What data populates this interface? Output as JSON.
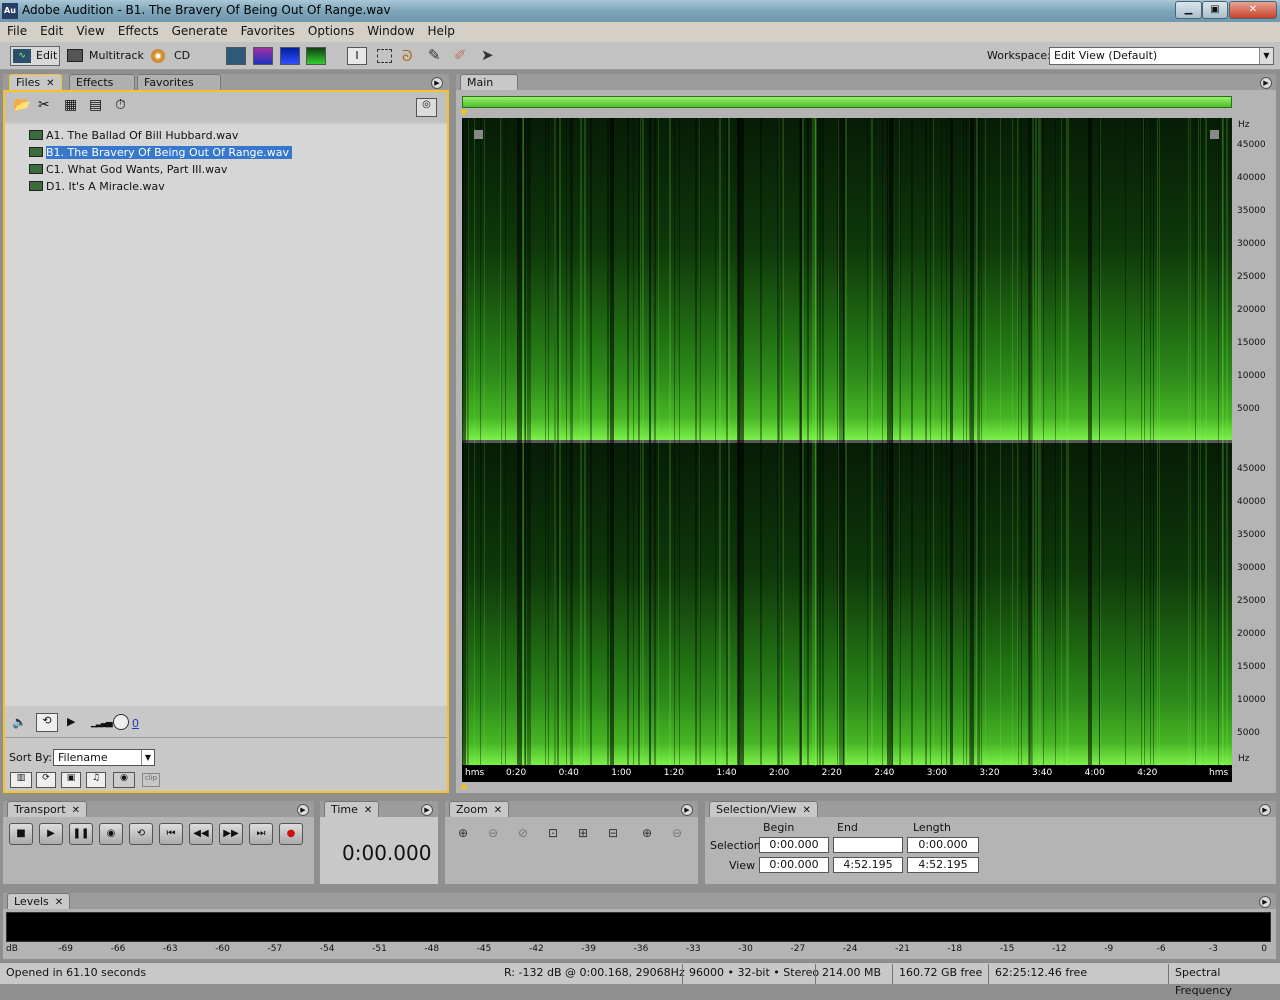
{
  "window": {
    "title": "Adobe Audition - B1. The Bravery Of Being Out Of Range.wav",
    "app_icon": "Au"
  },
  "menu": [
    "File",
    "Edit",
    "View",
    "Effects",
    "Generate",
    "Favorites",
    "Options",
    "Window",
    "Help"
  ],
  "toolbar": {
    "edit": "Edit",
    "multitrack": "Multitrack",
    "cd": "CD",
    "workspace_label": "Workspace:",
    "workspace_value": "Edit View (Default)"
  },
  "files_panel": {
    "tabs": [
      "Files",
      "Effects",
      "Favorites"
    ],
    "files": [
      "A1. The Ballad Of Bill Hubbard.wav",
      "B1. The Bravery Of Being Out Of Range.wav",
      "C1. What God Wants, Part III.wav",
      "D1. It's A Miracle.wav"
    ],
    "selected": 1,
    "volume_value": "0",
    "sort_label": "Sort By:",
    "sort_value": "Filename"
  },
  "main_panel": {
    "tab": "Main",
    "y_ticks": [
      "45000",
      "40000",
      "35000",
      "30000",
      "25000",
      "20000",
      "15000",
      "10000",
      "5000"
    ],
    "y_unit": "Hz",
    "x_ticks": [
      "0:20",
      "0:40",
      "1:00",
      "1:20",
      "1:40",
      "2:00",
      "2:20",
      "2:40",
      "3:00",
      "3:20",
      "3:40",
      "4:00",
      "4:20"
    ],
    "x_unit": "hms"
  },
  "transport": {
    "tab": "Transport"
  },
  "time": {
    "tab": "Time",
    "value": "0:00.000"
  },
  "zoom": {
    "tab": "Zoom"
  },
  "selection_view": {
    "tab": "Selection/View",
    "col_begin": "Begin",
    "col_end": "End",
    "col_length": "Length",
    "row_selection": "Selection",
    "row_view": "View",
    "sel_begin": "0:00.000",
    "sel_end": "",
    "sel_length": "0:00.000",
    "view_begin": "0:00.000",
    "view_end": "4:52.195",
    "view_length": "4:52.195"
  },
  "levels": {
    "tab": "Levels",
    "scale": [
      "dB",
      "-69",
      "-66",
      "-63",
      "-60",
      "-57",
      "-54",
      "-51",
      "-48",
      "-45",
      "-42",
      "-39",
      "-36",
      "-33",
      "-30",
      "-27",
      "-24",
      "-21",
      "-18",
      "-15",
      "-12",
      "-9",
      "-6",
      "-3",
      "0"
    ]
  },
  "status": {
    "opened": "Opened in 61.10 seconds",
    "cursor": "R: -132 dB @  0:00.168, 29068Hz",
    "format": "96000 • 32-bit • Stereo",
    "size": "214.00 MB",
    "free": "160.72 GB free",
    "time_free": "62:25:12.46 free",
    "view_mode": "Spectral Frequency"
  }
}
